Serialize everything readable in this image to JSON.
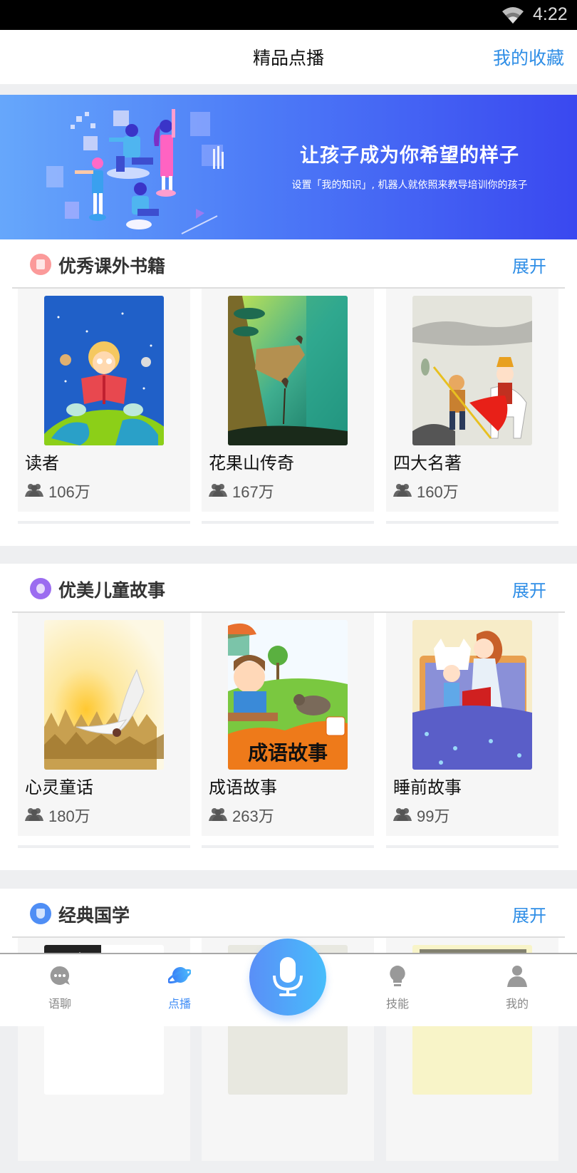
{
  "status_bar": {
    "time": "4:22",
    "wifi_icon": "wifi-icon"
  },
  "header": {
    "title": "精品点播",
    "favorites_label": "我的收藏"
  },
  "banner": {
    "headline": "让孩子成为你希望的样子",
    "subtitle": "设置「我的知识」, 机器人就依照来教导培训你的孩子"
  },
  "sections": [
    {
      "title": "优秀课外书籍",
      "icon": "book-icon",
      "icon_color": "#fb8e8e",
      "expand_label": "展开",
      "items": [
        {
          "name": "读者",
          "plays": "106万",
          "cover": "boy-reading-on-globe"
        },
        {
          "name": "花果山传奇",
          "plays": "167万",
          "cover": "monkeys-on-cliff"
        },
        {
          "name": "四大名著",
          "plays": "160万",
          "cover": "journey-to-the-west"
        }
      ]
    },
    {
      "title": "优美儿童故事",
      "icon": "story-icon",
      "icon_color": "#9b6cf0",
      "expand_label": "展开",
      "items": [
        {
          "name": "心灵童话",
          "plays": "180万",
          "cover": "crane-sunset"
        },
        {
          "name": "成语故事",
          "plays": "263万",
          "cover": "idiom-stories",
          "cover_text": "成语故事"
        },
        {
          "name": "睡前故事",
          "plays": "99万",
          "cover": "bedtime-mother-child"
        }
      ]
    },
    {
      "title": "经典国学",
      "icon": "graduation-icon",
      "icon_color": "#4f8ef5",
      "expand_label": "展开",
      "items": [
        {
          "name": "",
          "plays": "",
          "cover": "classic-1"
        },
        {
          "name": "",
          "plays": "",
          "cover": "classic-2"
        },
        {
          "name": "",
          "plays": "",
          "cover": "classic-3"
        }
      ]
    }
  ],
  "tabbar": {
    "tabs": [
      {
        "label": "语聊",
        "icon": "chat-icon",
        "active": false
      },
      {
        "label": "点播",
        "icon": "planet-icon",
        "active": true
      },
      {
        "label": "技能",
        "icon": "lightbulb-icon",
        "active": false
      },
      {
        "label": "我的",
        "icon": "user-icon",
        "active": false
      }
    ],
    "mic_icon": "microphone-icon"
  },
  "colors": {
    "accent": "#2f8ee6",
    "active_tab": "#3e8cf6",
    "banner_start": "#66a7fb",
    "banner_end": "#3a48f0"
  }
}
